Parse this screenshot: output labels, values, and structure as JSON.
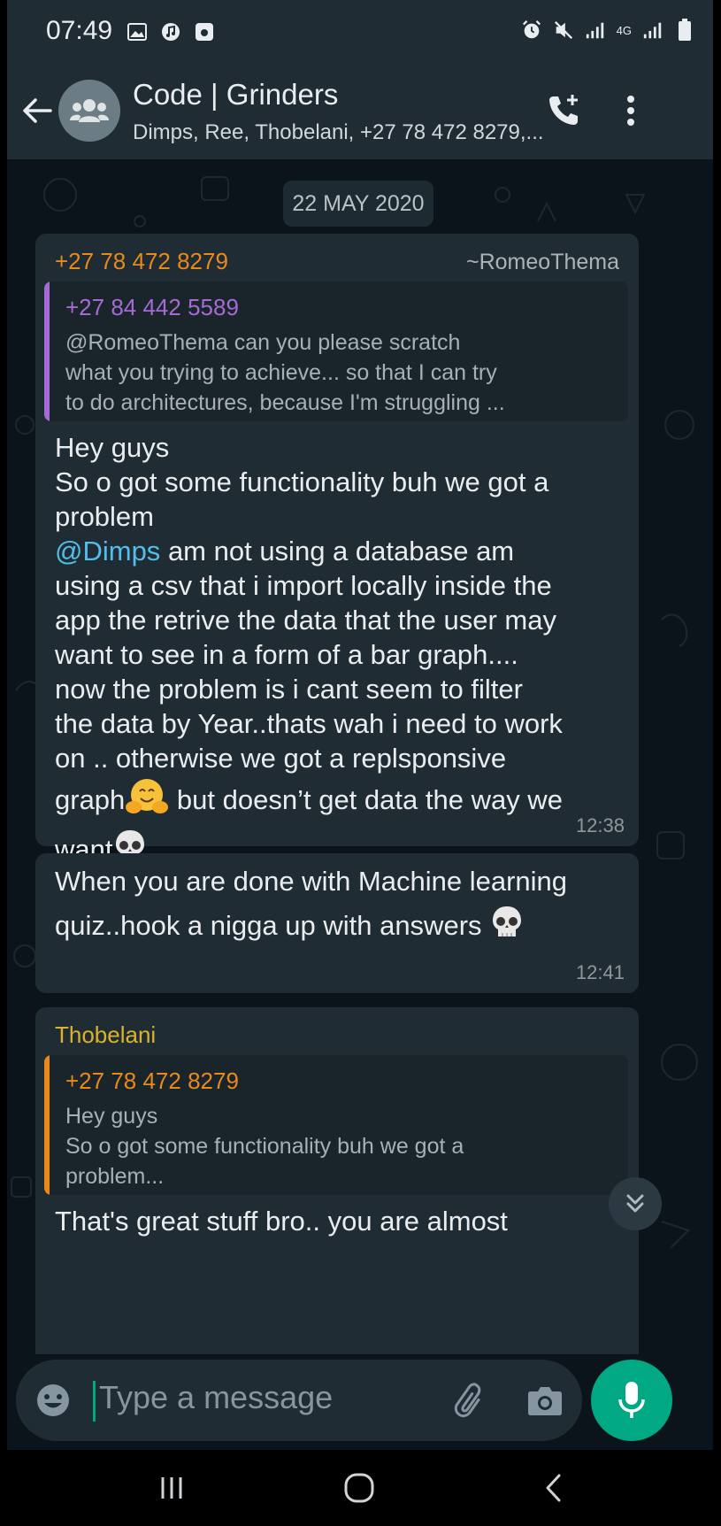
{
  "status_bar": {
    "time": "07:49",
    "network": "4G"
  },
  "header": {
    "title": "Code | Grinders",
    "subtitle": "Dimps, Ree, Thobelani, +27 78 472 8279,..."
  },
  "date_chip": "22 MAY 2020",
  "messages": [
    {
      "sender": "+27 78 472 8279",
      "sender_color": "#e8891c",
      "alias": "~RomeoThema",
      "quote": {
        "sender": "+27 84 442 5589",
        "sender_color": "#a56ad4",
        "lines": [
          "@RomeoThema can you please scratch",
          "what you trying to achieve... so that I can try",
          "to do architectures, because I'm struggling ..."
        ]
      },
      "lines": [
        "Hey guys",
        "So o got some functionality  buh we got a",
        "problem",
        "am not using a database am",
        "using a csv that i import locally inside the",
        "app the retrive the data that the user may",
        "want to see in a form of a bar graph....",
        "now the problem is i cant seem to filter",
        "the data by Year..thats wah i need to work",
        "on .. otherwise we got a replsponsive",
        "graph",
        "but doesn’t get data the way we",
        "want"
      ],
      "mention": "@Dimps",
      "time": "12:38"
    },
    {
      "lines": [
        "When you are done with Machine learning",
        "quiz..hook a nigga up with answers"
      ],
      "time": "12:41"
    },
    {
      "sender": "Thobelani",
      "sender_color": "#d9b32b",
      "quote": {
        "sender": "+27 78 472 8279",
        "sender_color": "#e8891c",
        "lines": [
          "Hey guys",
          "So o got some functionality  buh we got a",
          "problem..."
        ]
      },
      "lines": [
        "That's great stuff bro.. you are almost"
      ]
    }
  ],
  "input": {
    "placeholder": "Type a message"
  },
  "colors": {
    "accent": "#00a884",
    "header_bg": "#1f2c34",
    "chat_bg": "#0b141a",
    "bubble_bg": "#202c33"
  }
}
